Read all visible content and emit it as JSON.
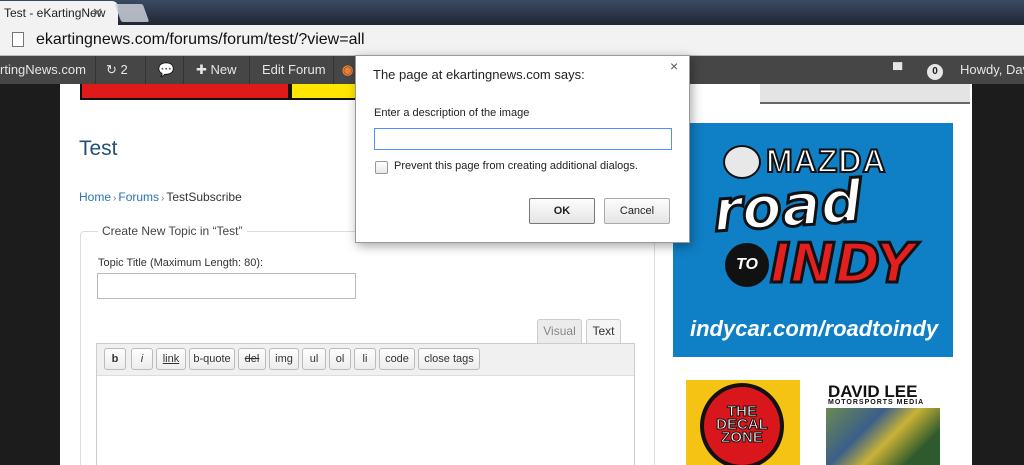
{
  "browser": {
    "tab_title": "Test - eKartingNew",
    "url": "ekartingnews.com/forums/forum/test/?view=all"
  },
  "adminbar": {
    "site_name": "rtingNews.com",
    "updates_count": "2",
    "new_label": "New",
    "edit_label": "Edit Forum",
    "notifications_count": "0",
    "howdy": "Howdy, Dav"
  },
  "forum": {
    "title": "Test",
    "breadcrumb": {
      "home": "Home",
      "forums": "Forums",
      "current": "TestSubscribe"
    },
    "form": {
      "legend": "Create New Topic in “Test”",
      "title_label": "Topic Title (Maximum Length: 80):",
      "title_value": ""
    },
    "editor_tabs": {
      "visual": "Visual",
      "text": "Text"
    },
    "quicktags": [
      "b",
      "i",
      "link",
      "b-quote",
      "del",
      "img",
      "ul",
      "ol",
      "li",
      "code",
      "close tags"
    ]
  },
  "ads": {
    "mazda_brand": "MAZDA",
    "mazda_road": "road",
    "mazda_to": "TO",
    "mazda_indy": "INDY",
    "mazda_url": "indycar.com/roadtoindy",
    "decal": "THE\nDECAL\nZONE",
    "david_name": "DAVID LEE",
    "david_sub": "MOTORSPORTS MEDIA"
  },
  "dialog": {
    "title": "The page at ekartingnews.com says:",
    "close": "×",
    "prompt": "Enter a description of the image",
    "input_value": "",
    "checkbox_label": "Prevent this page from creating additional dialogs.",
    "checked": false,
    "ok_label": "OK",
    "cancel_label": "Cancel"
  },
  "colors": {
    "link": "#2a72b5",
    "title": "#22507a",
    "adminbar": "#464646",
    "focus": "#4d90fe"
  }
}
